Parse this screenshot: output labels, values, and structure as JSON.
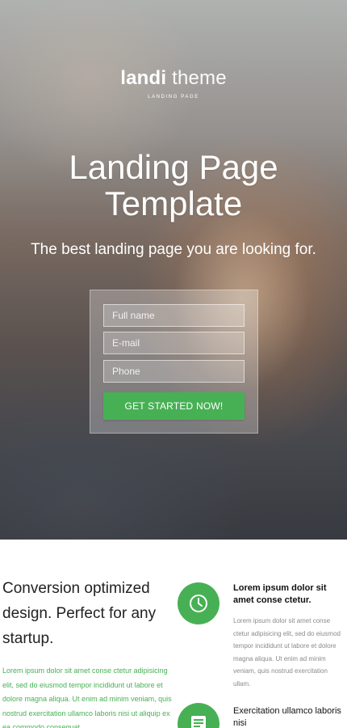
{
  "hero": {
    "brand_bold": "landi",
    "brand_light": "theme",
    "brand_subtitle": "LANDING PAGE",
    "title": "Landing Page Template",
    "tagline": "The best landing page you are looking for."
  },
  "form": {
    "name_placeholder": "Full name",
    "email_placeholder": "E-mail",
    "phone_placeholder": "Phone",
    "submit_label": "GET STARTED NOW!"
  },
  "content": {
    "headline": "Conversion optimized design. Perfect for any startup.",
    "intro": "Lorem ipsum dolor sit amet conse ctetur adipisicing elit, sed do eiusmod tempor incididunt ut labore et dolore magna aliqua. Ut enim ad minim veniam, quis nostrud exercitation ullamco laboris nisi ut aliquip ex ea commodo consequat."
  },
  "features": [
    {
      "icon": "clock-icon",
      "title": "Lorem ipsum dolor sit amet conse ctetur.",
      "text": "Lorem ipsum dolor sit amet conse ctetur adipisicing elit, sed do eiusmod tempor incididunt ut labore et dolore magna aliqua. Ut enim ad minim veniam, quis nostrud exercitation ullam."
    },
    {
      "icon": "list-icon",
      "title": "Exercitation ullamco laboris nisi"
    }
  ],
  "colors": {
    "accent": "#47b054",
    "heading": "#222222",
    "muted_text": "#8a8a8a"
  }
}
